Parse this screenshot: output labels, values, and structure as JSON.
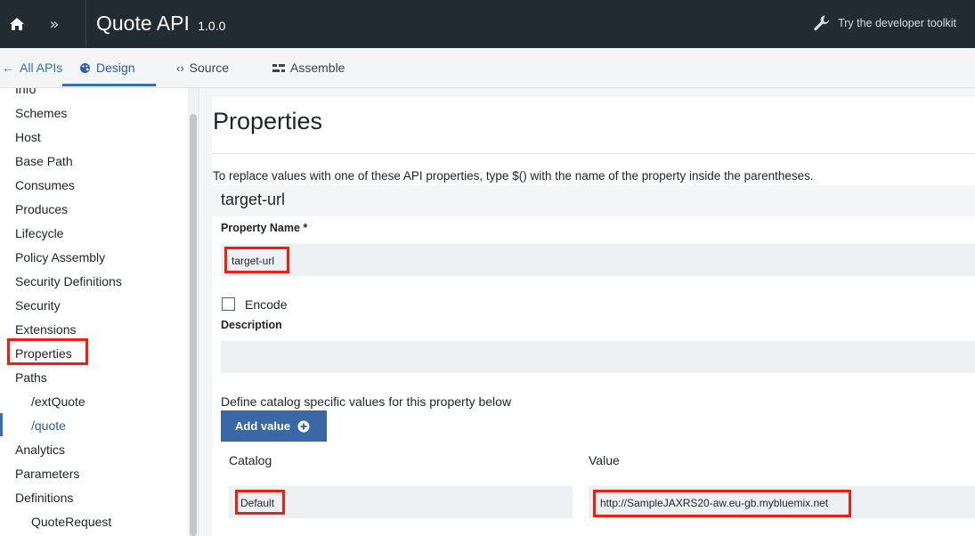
{
  "header": {
    "title": "Quote API",
    "version": "1.0.0",
    "toolkit_label": "Try the developer toolkit",
    "icons": {
      "home": "home-icon",
      "expand": "double-chevron-right-icon",
      "toolkit": "wrench-icon"
    }
  },
  "tabs": {
    "back_label": "All APIs",
    "design_label": "Design",
    "source_label": "Source",
    "assemble_label": "Assemble",
    "source_glyph": "‹›",
    "back_glyph": "←"
  },
  "sidebar": {
    "items": [
      "Info",
      "Schemes",
      "Host",
      "Base Path",
      "Consumes",
      "Produces",
      "Lifecycle",
      "Policy Assembly",
      "Security Definitions",
      "Security",
      "Extensions",
      "Properties",
      "Paths",
      "/extQuote",
      "/quote",
      "Analytics",
      "Parameters",
      "Definitions",
      "QuoteRequest"
    ]
  },
  "main": {
    "title": "Properties",
    "hint": "To replace values with one of these API properties, type $() with the name of the property inside the parentheses.",
    "property": {
      "heading": "target-url",
      "name_label": "Property Name *",
      "name_value": "target-url",
      "encode_label": "Encode",
      "description_label": "Description",
      "description_value": "",
      "define_text": "Define catalog specific values for this property below",
      "add_value_label": "Add value",
      "catalog_header": "Catalog",
      "value_header": "Value",
      "rows": [
        {
          "catalog": "Default",
          "value": "http://SampleJAXRS20-aw.eu-gb.mybluemix.net"
        }
      ]
    }
  },
  "colors": {
    "header_bg": "#232b32",
    "accent": "#3b6fb0",
    "button_bg": "#3a68a6",
    "highlight_red": "#ee1f10"
  }
}
